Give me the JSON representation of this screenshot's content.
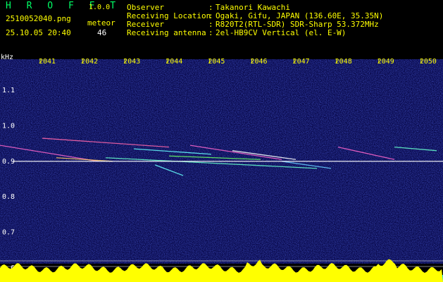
{
  "header": {
    "app_title": "H R O F F T",
    "version": "1.0.0",
    "filename": "2510052040.png",
    "datetime": "25.10.05 20:40",
    "meteor_label": "meteor",
    "meteor_count": "46"
  },
  "info": [
    {
      "label": "Observer",
      "value": "Takanori Kawachi"
    },
    {
      "label": "Receiving Location",
      "value": "Ogaki, Gifu, JAPAN (136.60E, 35.35N)"
    },
    {
      "label": "Receiver",
      "value": "R820T2(RTL-SDR) SDR-Sharp 53.372MHz"
    },
    {
      "label": "Receiving antenna",
      "value": "2el-HB9CV Vertical (el. E-W)"
    }
  ],
  "chart_data": {
    "type": "heatmap",
    "ylabel": "kHz",
    "x_ticks": [
      "2041",
      "2042",
      "2043",
      "2044",
      "2045",
      "2046",
      "2047",
      "2048",
      "2049",
      "2050"
    ],
    "y_ticks": [
      "1.1",
      "1.0",
      "0.9",
      "0.8",
      "0.7",
      "0.6"
    ],
    "ylim": [
      0.58,
      1.15
    ],
    "carrier_khz": 0.9,
    "colors": {
      "background": "#0a0a5a",
      "carrier": "#ffffff",
      "tick": "#ffff00",
      "histogram": "#ffff00",
      "histogram_base": "#00ccff",
      "grid": "#ffffff"
    }
  }
}
